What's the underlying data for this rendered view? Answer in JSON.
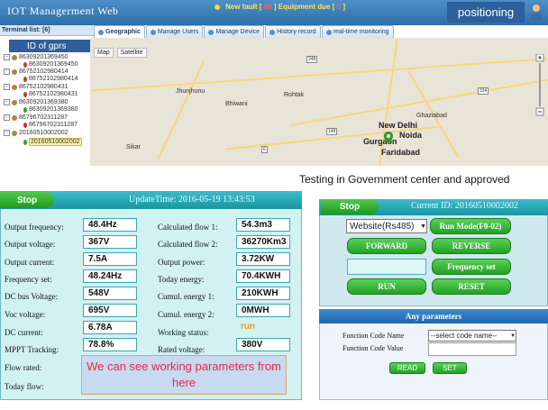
{
  "header": {
    "title": "IOT Managerment Web",
    "new_fault_label": "New fault [",
    "new_fault_count": "66",
    "equipment_due_label": "] Equipment due [",
    "equipment_due_count": "0",
    "alert_end": "]",
    "positioning_label": "positioning"
  },
  "terminal_list": {
    "header": "Terminal list: [6]",
    "gprs_label": "ID of gprs",
    "items": [
      "86309201369450",
      "86309201369450",
      "86752102980414",
      "86752102980414",
      "86752102980431",
      "86752102980431",
      "86309201369380",
      "86309201369380",
      "86796702311287",
      "86796702311287",
      "20160510002002",
      "20160510002002"
    ]
  },
  "tabs": [
    "Geographic",
    "Manage Users",
    "Manage Device",
    "History record",
    "real-time monitoring"
  ],
  "map": {
    "types": [
      "Map",
      "Satellite"
    ],
    "cities": [
      "Jhunjhunu",
      "Sikar",
      "Bhiwani",
      "Rohtak",
      "New Delhi",
      "Noida",
      "Gurgaon",
      "Faridabad",
      "Ghaziabad"
    ],
    "shields": [
      "248",
      "148",
      "6",
      "334"
    ]
  },
  "caption": "Testing in Government center and approved",
  "monitor": {
    "status_button": "Stop",
    "update_time": "UpdateTime: 2016-05-19 13:43:53",
    "left_params": [
      {
        "label": "Output frequency:",
        "value": "48.4Hz"
      },
      {
        "label": "Output voltage:",
        "value": "367V"
      },
      {
        "label": "Output current:",
        "value": "7.5A"
      },
      {
        "label": "Frequency set:",
        "value": "48.24Hz"
      },
      {
        "label": "DC bus Voltage:",
        "value": "548V"
      },
      {
        "label": "Voc voltage:",
        "value": "695V"
      },
      {
        "label": "DC current:",
        "value": "6.78A"
      },
      {
        "label": "MPPT Tracking:",
        "value": "78.8%"
      },
      {
        "label": "Flow rated:",
        "value": ""
      },
      {
        "label": "Today flow:",
        "value": ""
      }
    ],
    "right_params": [
      {
        "label": "Calculated flow 1:",
        "value": "54.3m3"
      },
      {
        "label": "Calculated flow 2:",
        "value": "36270Km3"
      },
      {
        "label": "Output power:",
        "value": "3.72KW"
      },
      {
        "label": "Today energy:",
        "value": "70.4KWH"
      },
      {
        "label": "Cumul. energy 1:",
        "value": "210KWH"
      },
      {
        "label": "Cumul. energy 2:",
        "value": "0MWH"
      },
      {
        "label": "Working status:",
        "value": "run"
      },
      {
        "label": "Rated voltage:",
        "value": "380V"
      }
    ],
    "note": "We can see working parameters from here"
  },
  "control": {
    "status_button": "Stop",
    "current_id": "Current ID: 20160510002002",
    "protocol_select": "Website(Rs485)",
    "run_mode_button": "Run Mode(F0-02)",
    "forward_button": "FORWARD",
    "reverse_button": "REVERSE",
    "frequency_set_button": "Frequency set",
    "run_button": "RUN",
    "reset_button": "RESET"
  },
  "any_params": {
    "title": "Any parameters",
    "code_name_label": "Function Code Name",
    "code_select": "--select code name--",
    "code_value_label": "Function Code Value",
    "read_button": "READ",
    "set_button": "SET"
  },
  "colors": {
    "header_blue": "#2d6ea8",
    "panel_teal": "#1a94a6",
    "button_green": "#23a223",
    "note_text": "#e6284a",
    "status_run": "#f09a1a"
  }
}
